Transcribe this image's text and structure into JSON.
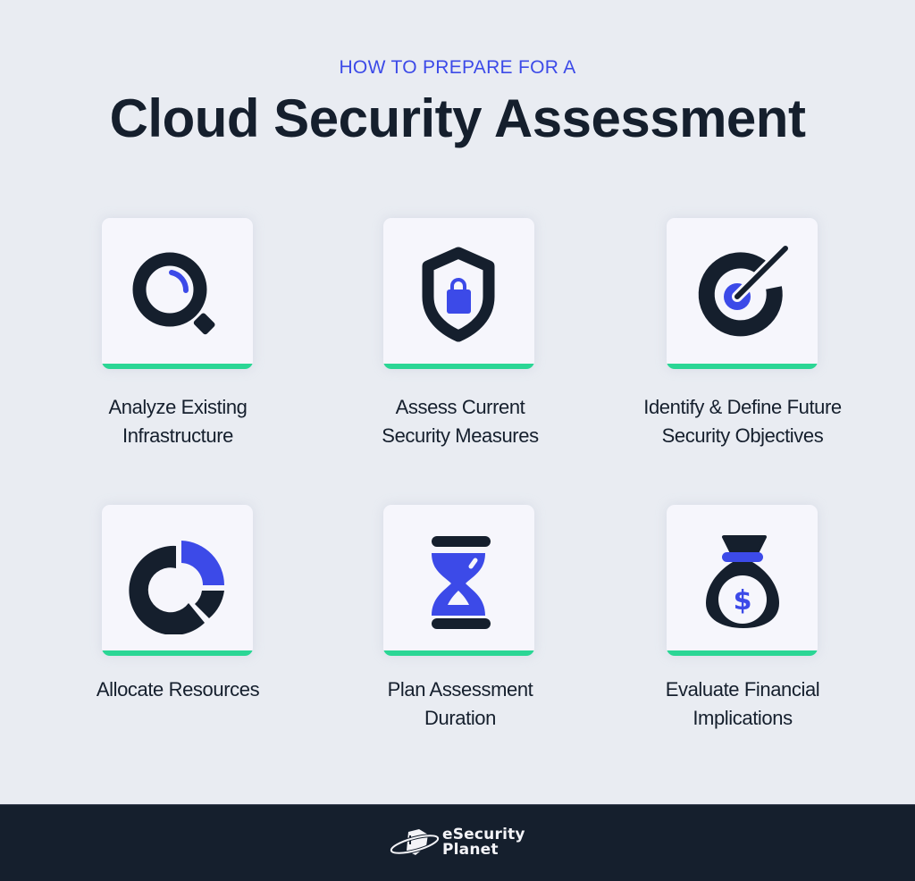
{
  "header": {
    "kicker": "HOW TO PREPARE FOR A",
    "title": "Cloud Security Assessment"
  },
  "colors": {
    "background": "#e9ecf2",
    "accent_blue": "#3c4ae8",
    "dark": "#151f2d",
    "card": "#f6f6fc",
    "green_bar": "#2bd695"
  },
  "steps": [
    {
      "icon": "magnifying-glass-icon",
      "label_line1": "Analyze Existing",
      "label_line2": "Infrastructure"
    },
    {
      "icon": "shield-lock-icon",
      "label_line1": "Assess Current",
      "label_line2": "Security Measures"
    },
    {
      "icon": "target-icon",
      "label_line1": "Identify & Define Future",
      "label_line2": "Security Objectives"
    },
    {
      "icon": "donut-chart-icon",
      "label_line1": "Allocate Resources",
      "label_line2": ""
    },
    {
      "icon": "hourglass-icon",
      "label_line1": "Plan Assessment",
      "label_line2": "Duration"
    },
    {
      "icon": "money-bag-icon",
      "label_line1": "Evaluate Financial",
      "label_line2": "Implications"
    }
  ],
  "footer": {
    "brand_line1": "eSecurity",
    "brand_line2": "Planet"
  }
}
